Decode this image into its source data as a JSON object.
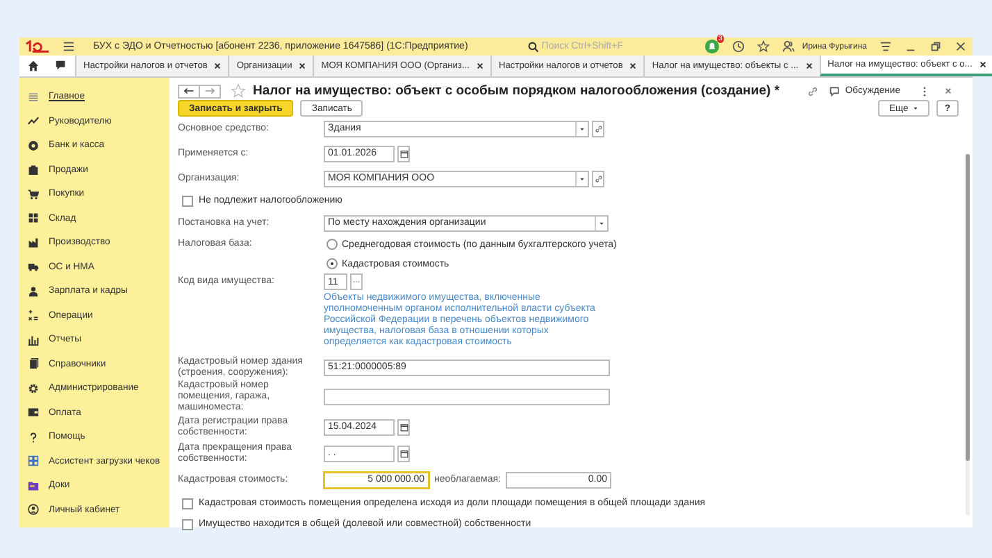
{
  "window": {
    "title": "БУХ с ЭДО и Отчетностью [абонент 2236, приложение 1647586]  (1С:Предприятие)",
    "search_placeholder": "Поиск Ctrl+Shift+F",
    "notification_count": "3",
    "user": "Ирина Фурыгина"
  },
  "tabs": [
    {
      "label": "Настройки налогов и отчетов",
      "selected": false
    },
    {
      "label": "Организации",
      "selected": false
    },
    {
      "label": "МОЯ КОМПАНИЯ ООО (Организ...",
      "selected": false
    },
    {
      "label": "Настройки налогов и отчетов",
      "selected": false
    },
    {
      "label": "Налог на имущество: объекты с ...",
      "selected": false
    },
    {
      "label": "Налог на имущество: объект с о...",
      "selected": true
    }
  ],
  "sidebar": {
    "items": [
      {
        "label": "Главное",
        "selected": true
      },
      {
        "label": "Руководителю",
        "selected": false
      },
      {
        "label": "Банк и касса",
        "selected": false
      },
      {
        "label": "Продажи",
        "selected": false
      },
      {
        "label": "Покупки",
        "selected": false
      },
      {
        "label": "Склад",
        "selected": false
      },
      {
        "label": "Производство",
        "selected": false
      },
      {
        "label": "ОС и НМА",
        "selected": false
      },
      {
        "label": "Зарплата и кадры",
        "selected": false
      },
      {
        "label": "Операции",
        "selected": false
      },
      {
        "label": "Отчеты",
        "selected": false
      },
      {
        "label": "Справочники",
        "selected": false
      },
      {
        "label": "Администрирование",
        "selected": false
      },
      {
        "label": "Оплата",
        "selected": false
      },
      {
        "label": "Помощь",
        "selected": false
      },
      {
        "label": "Ассистент загрузки чеков",
        "selected": false
      },
      {
        "label": "Доки",
        "selected": false
      },
      {
        "label": "Личный кабинет",
        "selected": false
      }
    ]
  },
  "form": {
    "title": "Налог на имущество: объект с особым порядком налогообложения (создание) *",
    "discussion": "Обсуждение",
    "more_button": "Еще",
    "help_button": "?",
    "buttons": [
      {
        "label": "Записать и закрыть",
        "kind": "primary"
      },
      {
        "label": "Записать",
        "kind": "secondary"
      }
    ],
    "rows": [
      {
        "kind": "select",
        "label": "Основное средство:",
        "value": "Здания",
        "open_button": true
      },
      {
        "kind": "date",
        "label": "Применяется с:",
        "value": "01.01.2026"
      },
      {
        "kind": "select",
        "label": "Организация:",
        "value": "МОЯ КОМПАНИЯ ООО",
        "open_button": true
      },
      {
        "kind": "checkbox",
        "label": "Не подлежит налогообложению",
        "checked": false
      },
      {
        "kind": "select",
        "label": "Постановка на учет:",
        "value": "По месту нахождения организации",
        "open_button": false
      },
      {
        "kind": "radio",
        "label": "Налоговая база:",
        "options": [
          {
            "label": "Среднегодовая стоимость (по данным бухгалтерского учета)",
            "selected": false
          },
          {
            "label": "Кадастровая стоимость",
            "selected": true
          }
        ]
      },
      {
        "kind": "code",
        "label": "Код вида имущества:",
        "value": "11",
        "note": "Объекты недвижимого имущества, включенные уполномоченным органом исполнительной власти субъекта Российской Федерации в перечень объектов недвижимого имущества, налоговая база в отношении которых определяется как кадастровая стоимость"
      },
      {
        "kind": "text",
        "label": "Кадастровый номер здания (строения, сооружения):",
        "value": "51:21:0000005:89"
      },
      {
        "kind": "text",
        "label": "Кадастровый номер помещения, гаража, машиноместа:",
        "value": ""
      },
      {
        "kind": "date",
        "label": "Дата регистрации права собственности:",
        "value": "15.04.2024"
      },
      {
        "kind": "date",
        "label": "Дата прекращения права собственности:",
        "value": " .  ."
      },
      {
        "kind": "money",
        "label": "Кадастровая стоимость:",
        "value": "5 000 000.00",
        "focused": true,
        "extra_label": "необлагаемая:",
        "extra_value": "0.00"
      },
      {
        "kind": "checkbox",
        "label": "Кадастровая стоимость помещения определена исходя из доли площади помещения в общей площади здания",
        "checked": false
      },
      {
        "kind": "checkbox",
        "label": "Имущество находится в общей (долевой или совместной) собственности",
        "checked": false
      }
    ]
  }
}
